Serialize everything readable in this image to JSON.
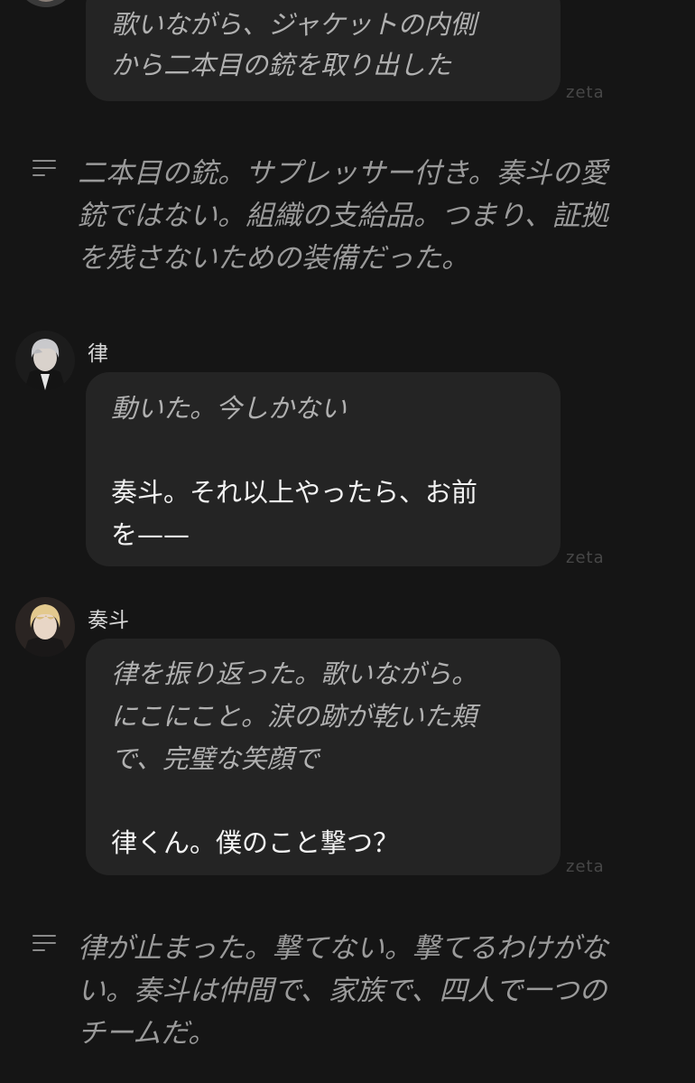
{
  "messages": [
    {
      "type": "bubble",
      "lines": [
        {
          "text": "歌いながら、ジャケットの内側",
          "style": "italic"
        },
        {
          "text": "から二本目の銃を取り出した",
          "style": "italic"
        }
      ],
      "watermark": "zeta"
    },
    {
      "type": "narration",
      "lines": [
        "二本目の銃。サプレッサー付き。奏斗の愛",
        "銃ではない。組織の支給品。つまり、証拠",
        "を残さないための装備だった。"
      ]
    },
    {
      "type": "bubble",
      "speaker": "律",
      "lines": [
        {
          "text": "動いた。今しかない",
          "style": "italic"
        },
        {
          "text": "奏斗。それ以上やったら、お前",
          "style": "speech"
        },
        {
          "text": "を——",
          "style": "speech"
        }
      ],
      "watermark": "zeta"
    },
    {
      "type": "bubble",
      "speaker": "奏斗",
      "lines": [
        {
          "text": "律を振り返った。歌いながら。",
          "style": "italic"
        },
        {
          "text": "にこにこと。涙の跡が乾いた頬",
          "style": "italic"
        },
        {
          "text": "で、完璧な笑顔で",
          "style": "italic"
        },
        {
          "text": "律くん。僕のこと撃つ？",
          "style": "speech"
        }
      ],
      "watermark": "zeta"
    },
    {
      "type": "narration",
      "lines": [
        "律が止まった。撃てない。撃てるわけがな",
        "い。奏斗は仲間で、家族で、四人で一つの",
        "チームだ。"
      ]
    }
  ],
  "icons": {
    "narration": "text-lines-icon",
    "avatar_ritsu": "avatar-ritsu",
    "avatar_kanato": "avatar-kanato"
  },
  "colors": {
    "background": "#151515",
    "bubble": "#242424",
    "italic_text": "#b0b0b0",
    "speech_text": "#f2f2f2",
    "narration_text": "#9a9a9a",
    "watermark": "#474747"
  }
}
